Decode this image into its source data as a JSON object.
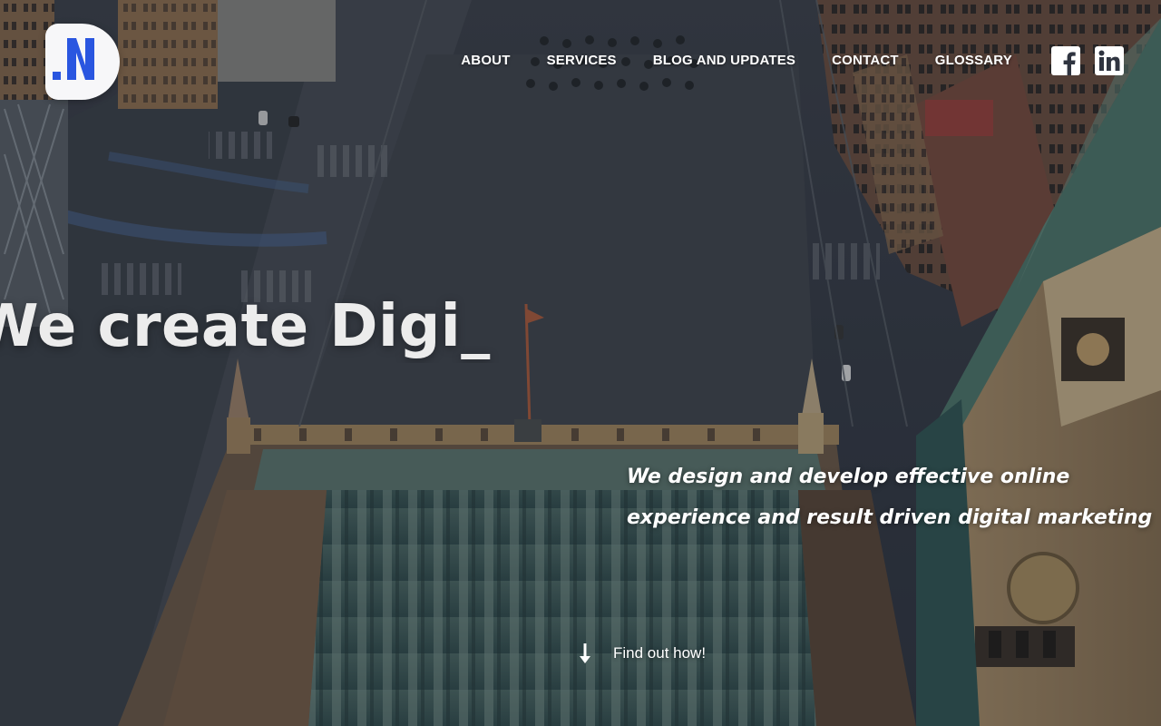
{
  "brand": {
    "logo_icon": "agency-logo-icon",
    "accent_color": "#2a56e0",
    "logo_bg_color": "#f7f7f9"
  },
  "nav": {
    "items": [
      {
        "label": "ABOUT"
      },
      {
        "label": "SERVICES"
      },
      {
        "label": "BLOG AND UPDATES"
      },
      {
        "label": "CONTACT"
      },
      {
        "label": "GLOSSARY"
      }
    ]
  },
  "social": {
    "facebook_icon": "facebook-icon",
    "linkedin_icon": "linkedin-icon"
  },
  "hero": {
    "headline": "We create Digi_",
    "tagline_line1": "We design and develop effective online",
    "tagline_line2": "experience and result driven digital marketing",
    "cta_label": "Find out how!",
    "cta_icon": "arrow-down-icon",
    "text_color": "#ffffff"
  }
}
